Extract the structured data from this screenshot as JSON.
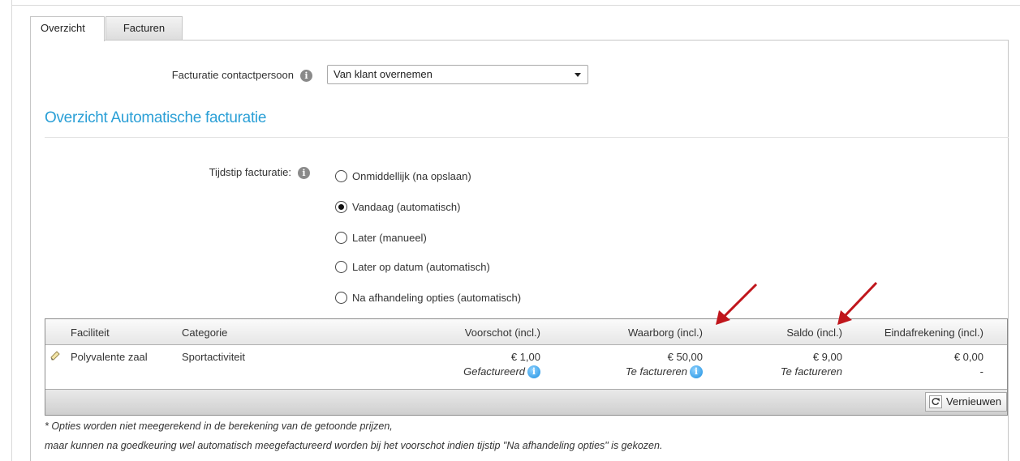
{
  "tabs": [
    {
      "label": "Overzicht",
      "active": true
    },
    {
      "label": "Facturen",
      "active": false
    }
  ],
  "contact": {
    "label": "Facturatie contactpersoon",
    "selected": "Van klant overnemen"
  },
  "section": {
    "title": "Overzicht Automatische facturatie"
  },
  "timing": {
    "label": "Tijdstip facturatie:",
    "options": [
      {
        "label": "Onmiddellijk (na opslaan)",
        "checked": false
      },
      {
        "label": "Vandaag (automatisch)",
        "checked": true
      },
      {
        "label": "Later (manueel)",
        "checked": false
      },
      {
        "label": "Later op datum (automatisch)",
        "checked": false
      },
      {
        "label": "Na afhandeling opties (automatisch)",
        "checked": false
      }
    ]
  },
  "table": {
    "headers": {
      "faciliteit": "Faciliteit",
      "categorie": "Categorie",
      "voorschot": "Voorschot (incl.)",
      "waarborg": "Waarborg (incl.)",
      "saldo": "Saldo (incl.)",
      "eindafrekening": "Eindafrekening (incl.)"
    },
    "rows": [
      {
        "faciliteit": "Polyvalente zaal",
        "categorie": "Sportactiviteit",
        "voorschot": "€ 1,00",
        "voorschot_status": "Gefactureerd",
        "waarborg": "€ 50,00",
        "waarborg_status": "Te factureren",
        "saldo": "€ 9,00",
        "saldo_status": "Te factureren",
        "eindafrekening": "€ 0,00",
        "eindafrekening_status": "-"
      }
    ],
    "refresh_label": "Vernieuwen"
  },
  "notes": [
    "* Opties worden niet meegerekend in de berekening van de getoonde prijzen,",
    "maar kunnen na goedkeuring wel automatisch meegefactureerd worden bij het voorschot indien tijstip \"Na afhandeling opties\" is gekozen."
  ],
  "colors": {
    "accent": "#2a9fd6",
    "arrow": "#c0161c"
  },
  "icons": [
    "info-icon",
    "edit-icon",
    "refresh-icon",
    "dropdown-caret-icon"
  ]
}
